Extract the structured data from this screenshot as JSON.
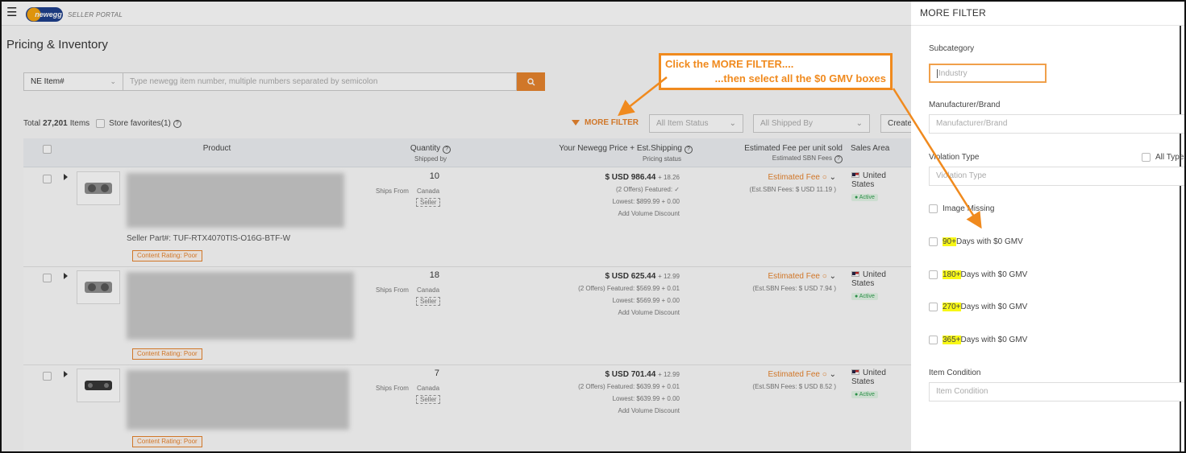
{
  "app": {
    "logo_mark": "newegg",
    "logo_text": "SELLER PORTAL",
    "page_title": "Pricing & Inventory"
  },
  "search": {
    "type_label": "NE Item#",
    "placeholder": "Type newegg item number, multiple numbers separated by semicolon"
  },
  "toolbar": {
    "total_prefix": "Total",
    "total_count": "27,201",
    "total_suffix": "Items",
    "store_favorites": "Store favorites(1)",
    "more_filter": "MORE FILTER",
    "item_status_placeholder": "All Item Status",
    "shipped_by_placeholder": "All Shipped By",
    "create_label": "Create"
  },
  "table": {
    "headers": {
      "product": "Product",
      "quantity": "Quantity",
      "quantity_sub": "Shipped by",
      "price": "Your Newegg Price + Est.Shipping",
      "price_sub": "Pricing status",
      "fee": "Estimated Fee per unit sold",
      "fee_sub": "Estimated SBN Fees",
      "sales_area": "Sales Area"
    },
    "rows": [
      {
        "seller_part": "Seller Part#:  TUF-RTX4070TIS-O16G-BTF-W",
        "content_rating": "Content Rating: Poor",
        "quantity": "10",
        "ships_from_label": "Ships From",
        "ships_from": "Canada",
        "shipped_by": "Seller",
        "price": "$ USD 986.44",
        "shipping": "+ 18.26",
        "offers": "(2 Offers) Featured: ✓",
        "lowest": "Lowest: $899.99 + 0.00",
        "volume_discount": "Add Volume Discount",
        "fee_label": "Estimated Fee",
        "sbn_fee": "(Est.SBN Fees: $ USD 11.19 )",
        "sales_area": "United States",
        "status": "Active"
      },
      {
        "seller_part": "",
        "content_rating": "Content Rating: Poor",
        "quantity": "18",
        "ships_from_label": "Ships From",
        "ships_from": "Canada",
        "shipped_by": "Seller",
        "price": "$ USD 625.44",
        "shipping": "+ 12.99",
        "offers": "(2 Offers) Featured: $569.99 + 0.01",
        "lowest": "Lowest: $569.99 + 0.00",
        "volume_discount": "Add Volume Discount",
        "fee_label": "Estimated Fee",
        "sbn_fee": "(Est.SBN Fees: $ USD 7.94 )",
        "sales_area": "United States",
        "status": "Active"
      },
      {
        "seller_part": "",
        "content_rating": "Content Rating: Poor",
        "quantity": "7",
        "ships_from_label": "Ships From",
        "ships_from": "Canada",
        "shipped_by": "Seller",
        "price": "$ USD 701.44",
        "shipping": "+ 12.99",
        "offers": "(2 Offers) Featured: $639.99 + 0.01",
        "lowest": "Lowest: $639.99 + 0.00",
        "volume_discount": "Add Volume Discount",
        "fee_label": "Estimated Fee",
        "sbn_fee": "(Est.SBN Fees: $ USD 8.52 )",
        "sales_area": "United States",
        "status": "Active"
      }
    ]
  },
  "callout": {
    "line1": "Click the MORE FILTER....",
    "line2": "...then select all the $0 GMV boxes",
    "color": "#f08a1e"
  },
  "panel": {
    "title": "MORE FILTER",
    "subcategory_label": "Subcategory",
    "subcategory_placeholder": "Industry",
    "manufacturer_label": "Manufacturer/Brand",
    "manufacturer_placeholder": "Manufacturer/Brand",
    "violation_label": "Violation Type",
    "violation_placeholder": "Violation Type",
    "all_types": "All Types",
    "image_missing": "Image Missing",
    "gmv": [
      {
        "highlight": "90+",
        "rest": " Days with $0 GMV"
      },
      {
        "highlight": "180+",
        "rest": " Days with $0 GMV"
      },
      {
        "highlight": "270+",
        "rest": " Days with $0 GMV"
      },
      {
        "highlight": "365+",
        "rest": " Days with $0 GMV"
      }
    ],
    "item_condition_label": "Item Condition",
    "item_condition_placeholder": "Item Condition"
  },
  "colors": {
    "accent": "#e8822a",
    "highlight": "#f7f716"
  }
}
